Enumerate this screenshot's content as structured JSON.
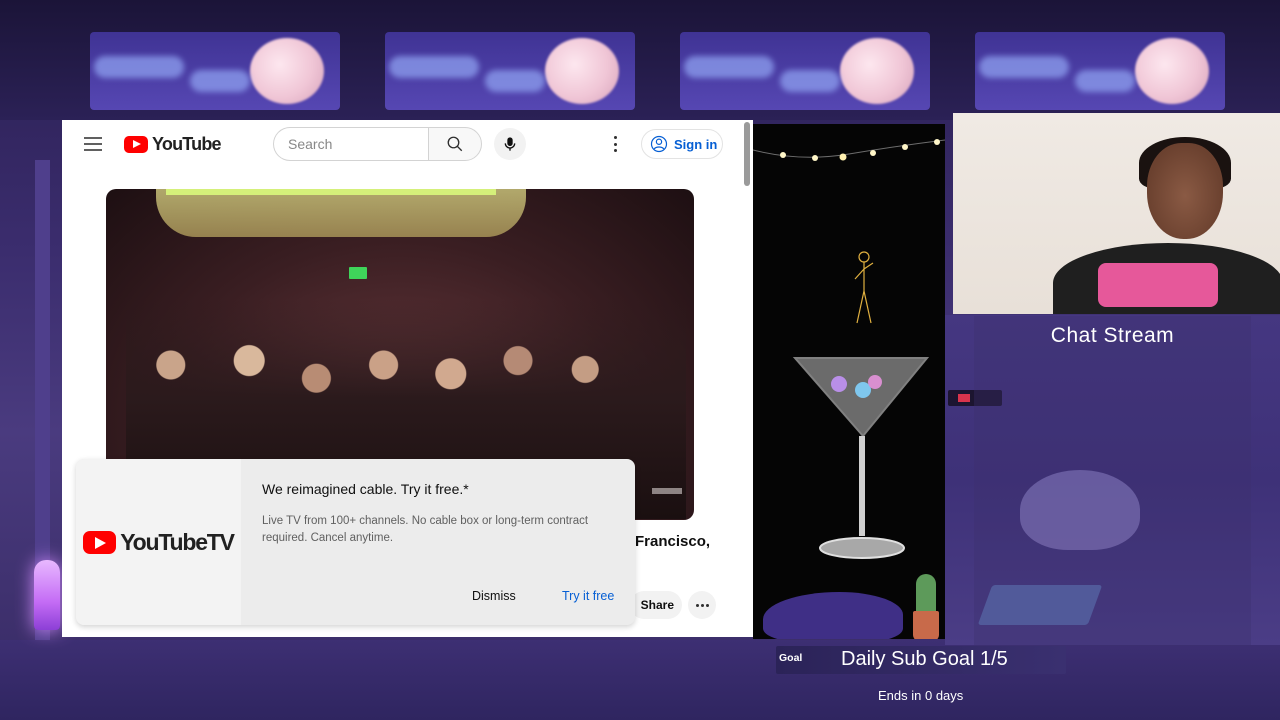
{
  "youtube": {
    "logo_text": "YouTube",
    "search": {
      "placeholder": "Search"
    },
    "sign_in_label": "Sign in",
    "video": {
      "title_fragment": "Francisco,",
      "share_label": "Share"
    },
    "promo": {
      "logo_text": "YouTubeTV",
      "headline": "We reimagined cable. Try it free.*",
      "body": "Live TV from 100+ channels. No cable box or long-term contract required. Cancel anytime.",
      "dismiss_label": "Dismiss",
      "try_label": "Try it free"
    },
    "brand_color": "#ff0000",
    "link_color": "#065fd4"
  },
  "overlay": {
    "chat_title": "Chat Stream",
    "goal": {
      "badge": "Goal",
      "label": "Daily Sub Goal 1/5",
      "ends": "Ends in 0 days",
      "current": 1,
      "target": 5
    }
  },
  "icons": {
    "menu": "hamburger-icon",
    "search": "search-icon",
    "mic": "microphone-icon",
    "more": "more-vert-icon",
    "account": "account-circle-icon",
    "more_horiz": "more-horiz-icon"
  }
}
